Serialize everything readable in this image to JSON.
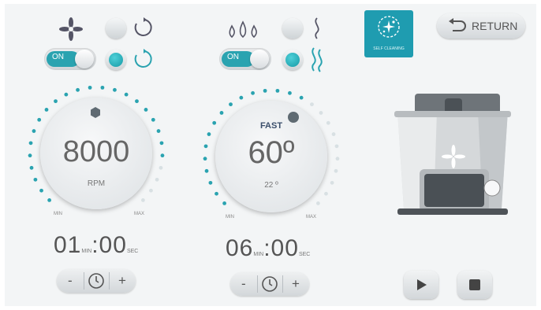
{
  "return_button": {
    "label": "RETURN"
  },
  "self_cleaning": {
    "label": "SELF CLEANING"
  },
  "mixer": {
    "toggle_label": "ON",
    "speed_value": "8000",
    "speed_unit": "RPM",
    "min_label": "MIN",
    "max_label": "MAX",
    "time_min": "01",
    "time_min_unit": "MIN",
    "time_sec": ":00",
    "time_sec_unit": "SEC",
    "decrement": "-",
    "increment": "+",
    "ticks": 26,
    "active_ticks": 22
  },
  "heater": {
    "toggle_label": "ON",
    "mode_label": "FAST",
    "temp_value": "60º",
    "current_temp": "22 º",
    "min_label": "MIN",
    "max_label": "MAX",
    "time_min": "06",
    "time_min_unit": "MIN",
    "time_sec": ":00",
    "time_sec_unit": "SEC",
    "decrement": "-",
    "increment": "+",
    "ticks": 26,
    "active_ticks": 16
  },
  "colors": {
    "accent": "#2aa3b0",
    "tick_inactive": "#d8e0e3",
    "panel": "#f3f5f6"
  }
}
